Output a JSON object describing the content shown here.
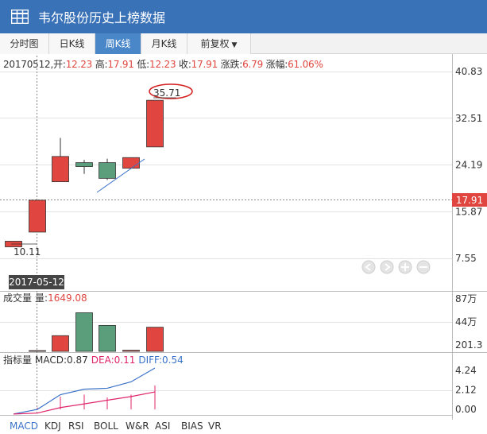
{
  "window": {
    "title": "韦尔股份历史上榜数据"
  },
  "tabs": [
    {
      "label": "分时图",
      "active": false
    },
    {
      "label": "日K线",
      "active": false
    },
    {
      "label": "周K线",
      "active": true
    },
    {
      "label": "月K线",
      "active": false
    },
    {
      "label": "前复权",
      "active": false,
      "dropdown": true
    }
  ],
  "info": {
    "date": "20170512,",
    "open_label": "开:",
    "open": "12.23",
    "high_label": "高:",
    "high": "17.91",
    "low_label": "低:",
    "low": "12.23",
    "close_label": "收:",
    "close": "17.91",
    "change_label": "涨跌:",
    "change": "6.79",
    "pct_label": "涨幅:",
    "pct": "61.06%"
  },
  "colors": {
    "up": "#e0463f",
    "down": "#5a9e7c",
    "accent": "#3a72b8",
    "macd_line": "#3a72c8",
    "dea_line": "#e0246a"
  },
  "chart_data": [
    {
      "type": "candlestick",
      "y_ticks": [
        "40.83",
        "32.51",
        "24.19",
        "15.87",
        "7.55"
      ],
      "ylim": [
        2.0,
        43.5
      ],
      "candles": [
        {
          "o": 9.6,
          "c": 10.6,
          "h": 10.6,
          "l": 9.6
        },
        {
          "o": 12.23,
          "c": 17.91,
          "h": 17.91,
          "l": 12.23
        },
        {
          "o": 21.2,
          "c": 25.7,
          "h": 29.0,
          "l": 21.2
        },
        {
          "o": 24.6,
          "c": 23.9,
          "h": 25.1,
          "l": 22.6
        },
        {
          "o": 24.6,
          "c": 21.8,
          "h": 25.3,
          "l": 21.5
        },
        {
          "o": 23.6,
          "c": 25.5,
          "h": 25.5,
          "l": 23.6
        },
        {
          "o": 27.4,
          "c": 35.71,
          "h": 35.71,
          "l": 27.4
        }
      ],
      "low_label": "10.11",
      "high_label": "35.71",
      "last_price_label": "17.91",
      "crosshair_date": "2017-05-12"
    },
    {
      "type": "bar",
      "title": "成交量",
      "label": "量:",
      "value": "1649.08",
      "y_ticks": [
        "87万",
        "44万",
        "201.3"
      ],
      "ylim": [
        0,
        870000
      ],
      "values": [
        {
          "v": 12000,
          "dir": "up"
        },
        {
          "v": 260000,
          "dir": "up"
        },
        {
          "v": 640000,
          "dir": "down"
        },
        {
          "v": 430000,
          "dir": "down"
        },
        {
          "v": 18000,
          "dir": "up"
        },
        {
          "v": 400000,
          "dir": "up"
        }
      ]
    },
    {
      "type": "line",
      "title": "指标量",
      "macd_label": "MACD:",
      "macd": "0.87",
      "dea_label": "DEA:",
      "dea": "0.11",
      "diff_label": "DIFF:",
      "diff": "0.54",
      "y_ticks": [
        "4.24",
        "2.12",
        "0.00"
      ],
      "ylim": [
        -0.6,
        4.5
      ],
      "series": [
        {
          "values": [
            -0.5,
            0.0,
            1.6,
            2.2,
            2.3,
            3.0,
            4.5
          ]
        },
        {
          "values": [
            -0.5,
            -0.4,
            0.2,
            0.6,
            1.0,
            1.4,
            1.9
          ]
        }
      ],
      "bars": [
        0.0,
        0.2,
        1.4,
        1.6,
        1.3,
        1.6,
        2.6
      ]
    }
  ],
  "bottom_tabs": [
    "MACD",
    "KDJ",
    "RSI",
    "BOLL",
    "W&R",
    "ASI",
    "BIAS",
    "VR"
  ],
  "icons": {
    "nav": [
      "prev-icon",
      "next-icon",
      "zoom-in-icon",
      "zoom-out-icon"
    ]
  }
}
